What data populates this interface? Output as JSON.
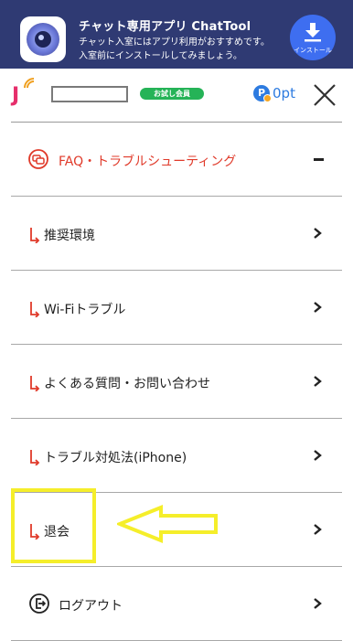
{
  "banner": {
    "title": "チャット専用アプリ ChatTool",
    "desc_line1": "チャット入室にはアプリ利用がおすすめです。",
    "desc_line2": "入室前にインストールしてみましょう。",
    "install_label": "インストール",
    "background": "#2f3a73",
    "install_color": "#3e6ef0"
  },
  "header": {
    "logo": "J",
    "member_badge": "お試し会員",
    "points_icon": "P",
    "points_value": "0pt"
  },
  "menu": {
    "faq_label": "FAQ・トラブルシューティング",
    "items": [
      {
        "label": "推奨環境"
      },
      {
        "label": "Wi-Fiトラブル"
      },
      {
        "label": "よくある質問・お問い合わせ"
      },
      {
        "label": "トラブル対処法(iPhone)"
      },
      {
        "label": "退会"
      }
    ],
    "logout_label": "ログアウト"
  },
  "colors": {
    "accent_red": "#e03a2a",
    "badge_green": "#25b357",
    "points_blue": "#2d7be0",
    "annotation_yellow": "#f5ee2a"
  }
}
